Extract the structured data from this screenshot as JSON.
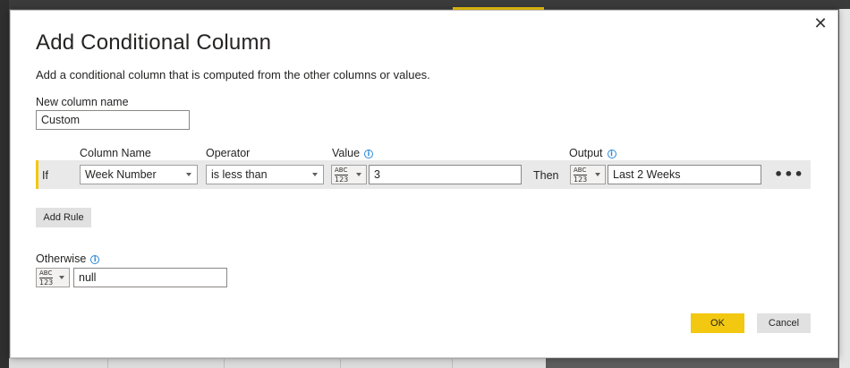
{
  "dialog": {
    "title": "Add Conditional Column",
    "subtitle": "Add a conditional column that is computed from the other columns or values.",
    "close_glyph": "✕"
  },
  "new_column": {
    "label": "New column name",
    "value": "Custom"
  },
  "headers": {
    "column_name": "Column Name",
    "operator": "Operator",
    "value": "Value",
    "output": "Output"
  },
  "rule": {
    "if_label": "If",
    "column": "Week Number",
    "operator": "is less than",
    "value": "3",
    "then_label": "Then",
    "output": "Last 2 Weeks",
    "more_glyph": "•••"
  },
  "type_icon": {
    "top": "ABC",
    "bottom": "123"
  },
  "add_rule_label": "Add Rule",
  "otherwise": {
    "label": "Otherwise",
    "value": "null"
  },
  "footer": {
    "ok_label": "OK",
    "cancel_label": "Cancel"
  },
  "colors": {
    "accent": "#f2c811",
    "info": "#2b88d8",
    "row_bg": "#e9e9e9"
  },
  "icons": {
    "info": "info-icon",
    "close": "close-icon",
    "dropdown": "chevron-down-icon",
    "type": "any-type-icon",
    "more": "ellipsis-icon"
  }
}
